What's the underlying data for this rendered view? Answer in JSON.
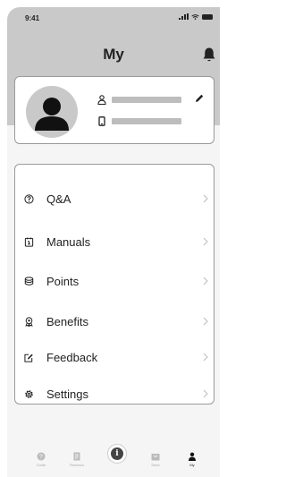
{
  "status_bar": {
    "time": "9:41"
  },
  "header": {
    "title": "My"
  },
  "menu": {
    "items": [
      {
        "label": "Q&A",
        "icon": "question-circle-icon"
      },
      {
        "label": "Manuals",
        "icon": "manual-icon"
      },
      {
        "label": "Points",
        "icon": "coins-icon"
      },
      {
        "label": "Benefits",
        "icon": "award-icon"
      },
      {
        "label": "Feedback",
        "icon": "feedback-icon"
      },
      {
        "label": "Settings",
        "icon": "gear-icon"
      }
    ]
  },
  "tabbar": {
    "guide": "Guide",
    "research": "Reseach",
    "center": "i",
    "store": "Store",
    "my": "My"
  },
  "colors": {
    "header_bg": "#c9c9c9",
    "card_border": "#9a9a9a",
    "placeholder": "#bdbdbd"
  }
}
